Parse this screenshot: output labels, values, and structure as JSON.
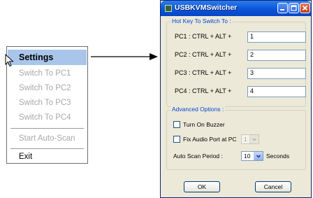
{
  "context_menu": {
    "items": [
      {
        "label": "Settings",
        "state": "highlighted"
      },
      {
        "label": "Switch To PC1",
        "state": "disabled"
      },
      {
        "label": "Switch To PC2",
        "state": "disabled"
      },
      {
        "label": "Switch To PC3",
        "state": "disabled"
      },
      {
        "label": "Switch To PC4",
        "state": "disabled"
      },
      {
        "label": "Start Auto-Scan",
        "state": "disabled"
      },
      {
        "label": "Exit",
        "state": "enabled"
      }
    ]
  },
  "dialog": {
    "title": "USBKVMSwitcher",
    "hotkey_group": {
      "title": "Hot Key To Switch To :",
      "rows": [
        {
          "label": "PC1 : CTRL + ALT +",
          "value": "1"
        },
        {
          "label": "PC2 : CTRL + ALT +",
          "value": "2"
        },
        {
          "label": "PC3 : CTRL + ALT +",
          "value": "3"
        },
        {
          "label": "PC4 : CTRL + ALT +",
          "value": "4"
        }
      ]
    },
    "advanced_group": {
      "title": "Advanced Options :",
      "turn_on_buzzer": {
        "label": "Turn On Buzzer",
        "checked": false
      },
      "fix_audio_port": {
        "label": "Fix Audio Port at PC",
        "checked": false,
        "value": "1",
        "enabled": false
      },
      "auto_scan": {
        "label": "Auto Scan Period :",
        "value": "10",
        "unit": "Seconds"
      }
    },
    "ok_label": "OK",
    "cancel_label": "Cancel"
  },
  "colors": {
    "menu_highlight": "#a9c6ea",
    "titlebar": "#0a55d8",
    "group_title": "#0046d5",
    "dialog_bg": "#ece9d8"
  }
}
